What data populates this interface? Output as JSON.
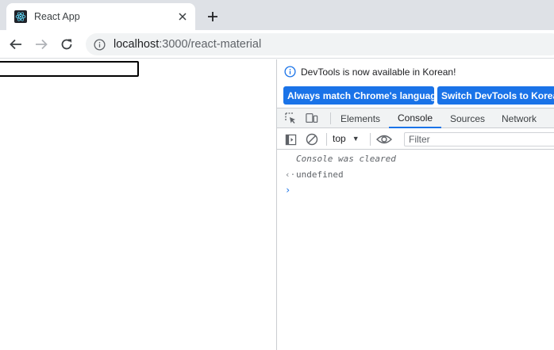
{
  "browser": {
    "tab": {
      "title": "React App"
    },
    "new_tab_label": "+",
    "url": {
      "host": "localhost",
      "path": ":3000/react-material"
    }
  },
  "devtools": {
    "notice": {
      "text": "DevTools is now available in Korean!",
      "button_primary": "Always match Chrome's language",
      "button_secondary": "Switch DevTools to Korean"
    },
    "tabs": [
      {
        "label": "Elements"
      },
      {
        "label": "Console"
      },
      {
        "label": "Sources"
      },
      {
        "label": "Network"
      }
    ],
    "active_tab": "Console",
    "console": {
      "context": "top",
      "filter_placeholder": "Filter",
      "lines": {
        "cleared": "Console was cleared",
        "result_arrow": "‹·",
        "result": "undefined",
        "prompt": "›"
      }
    }
  },
  "colors": {
    "accent": "#1a73e8",
    "tabstrip": "#dee1e6",
    "devtools_toolbar": "#f1f3f4"
  },
  "icons": [
    "react-favicon",
    "close-icon",
    "back-arrow-icon",
    "forward-arrow-icon",
    "reload-icon",
    "info-icon",
    "inspect-icon",
    "device-toggle-icon",
    "sidebar-icon",
    "clear-console-icon",
    "eye-icon"
  ]
}
